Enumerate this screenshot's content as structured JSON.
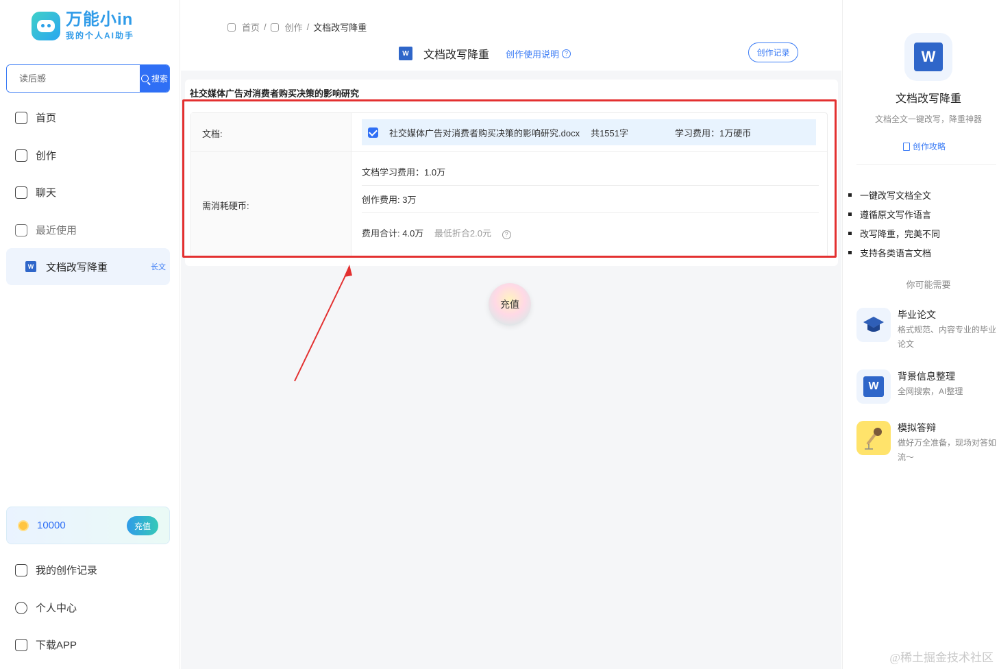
{
  "logo": {
    "title": "万能小in",
    "subtitle": "我的个人AI助手"
  },
  "search": {
    "placeholder": "读后感",
    "button": "搜索"
  },
  "nav": [
    {
      "label": "首页",
      "icon": "home-icon"
    },
    {
      "label": "创作",
      "icon": "edit-icon"
    },
    {
      "label": "聊天",
      "icon": "chat-icon"
    },
    {
      "label": "最近使用",
      "icon": "recent-icon"
    }
  ],
  "recent_item": {
    "label": "文档改写降重",
    "tag": "长文"
  },
  "coins": {
    "value": "10000",
    "button": "充值"
  },
  "bottom_nav": [
    {
      "label": "我的创作记录",
      "icon": "record-icon"
    },
    {
      "label": "个人中心",
      "icon": "user-icon"
    },
    {
      "label": "下载APP",
      "icon": "app-icon"
    }
  ],
  "breadcrumb": {
    "home": "首页",
    "create": "创作",
    "current": "文档改写降重",
    "sep": "/"
  },
  "header": {
    "title": "文档改写降重",
    "help": "创作使用说明",
    "record_button": "创作记录"
  },
  "card": {
    "title": "社交媒体广告对消费者购买决策的影响研究",
    "doc_label": "文档:",
    "doc_name": "社交媒体广告对消费者购买决策的影响研究.docx",
    "doc_words": "共1551字",
    "doc_fee": "学习费用：1万硬币",
    "cost_label": "需消耗硬币:",
    "learn_fee": "文档学习费用：1.0万",
    "create_fee": "创作费用:  3万",
    "total_fee": "费用合计:  4.0万",
    "total_min": "最低折合2.0元"
  },
  "recharge_button": "充值",
  "right": {
    "title": "文档改写降重",
    "desc": "文档全文一键改写，降重神器",
    "guide": "创作攻略",
    "features": [
      "一键改写文档全文",
      "遵循原文写作语言",
      "改写降重，完美不同",
      "支持各类语言文档"
    ],
    "maybe": "你可能需要",
    "recs": [
      {
        "name": "毕业论文",
        "desc": "格式规范、内容专业的毕业论文",
        "icon": "graduation-cap-icon"
      },
      {
        "name": "背景信息整理",
        "desc": "全网搜索，AI整理",
        "icon": "word-doc-icon"
      },
      {
        "name": "模拟答辩",
        "desc": "做好万全准备，现场对答如流～",
        "icon": "microphone-icon"
      }
    ]
  },
  "watermark": "@稀土掘金技术社区",
  "colors": {
    "accent": "#2f6ff5",
    "highlight_border": "#e33030",
    "brand": "#2f9be8"
  }
}
